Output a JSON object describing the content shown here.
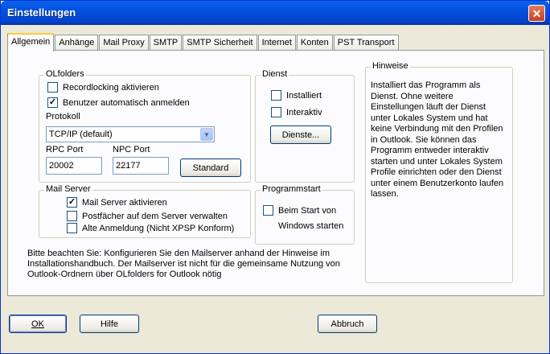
{
  "window": {
    "title": "Einstellungen",
    "close_icon": "close-icon"
  },
  "tabs": [
    {
      "label": "Allgemein",
      "active": true
    },
    {
      "label": "Anhänge"
    },
    {
      "label": "Mail Proxy"
    },
    {
      "label": "SMTP"
    },
    {
      "label": "SMTP Sicherheit"
    },
    {
      "label": "Internet"
    },
    {
      "label": "Konten"
    },
    {
      "label": "PST Transport"
    }
  ],
  "olfolders": {
    "title": "OLfolders",
    "recordlocking": {
      "label": "Recordlocking aktivieren",
      "checked": false
    },
    "autologin": {
      "label": "Benutzer automatisch anmelden",
      "checked": true
    },
    "protokoll_label": "Protokoll",
    "protokoll_value": "TCP/IP (default)",
    "rpc_label": "RPC Port",
    "rpc_value": "20002",
    "npc_label": "NPC Port",
    "npc_value": "22177",
    "standard_button": "Standard"
  },
  "dienst": {
    "title": "Dienst",
    "installiert": {
      "label": "Installiert",
      "checked": false
    },
    "interaktiv": {
      "label": "Interaktiv",
      "checked": false
    },
    "dienste_button": "Dienste..."
  },
  "hinweise": {
    "title": "Hinweise",
    "text": "Installiert das Programm als Dienst. Ohne weitere Einstellungen läuft der Dienst unter Lokales System und hat keine Verbindung mit den Profilen in Outlook. Sie können das Programm entweder interaktiv starten und unter Lokales System Profile einrichten oder den Dienst unter einem Benutzerkonto laufen lassen."
  },
  "mailserver": {
    "title": "Mail Server",
    "aktivieren": {
      "label": "Mail Server aktivieren",
      "checked": true
    },
    "postfaecher": {
      "label": "Postfächer auf dem Server verwalten",
      "checked": false
    },
    "alte_anmeldung": {
      "label": "Alte Anmeldung (Nicht XPSP Konform)",
      "checked": false
    }
  },
  "programmstart": {
    "title": "Programmstart",
    "beim_start": {
      "label": "Beim Start von",
      "checked": false
    },
    "windows_starten": "Windows starten"
  },
  "note": "Bitte beachten Sie:  Konfigurieren Sie den Mailserver anhand der Hinweise im Installationshandbuch.  Der Mailserver ist nicht für die gemeinsame Nutzung von Outlook-Ordnern über OLfolders for Outlook nötig",
  "footer": {
    "ok": "OK",
    "hilfe": "Hilfe",
    "abbruch": "Abbruch"
  }
}
